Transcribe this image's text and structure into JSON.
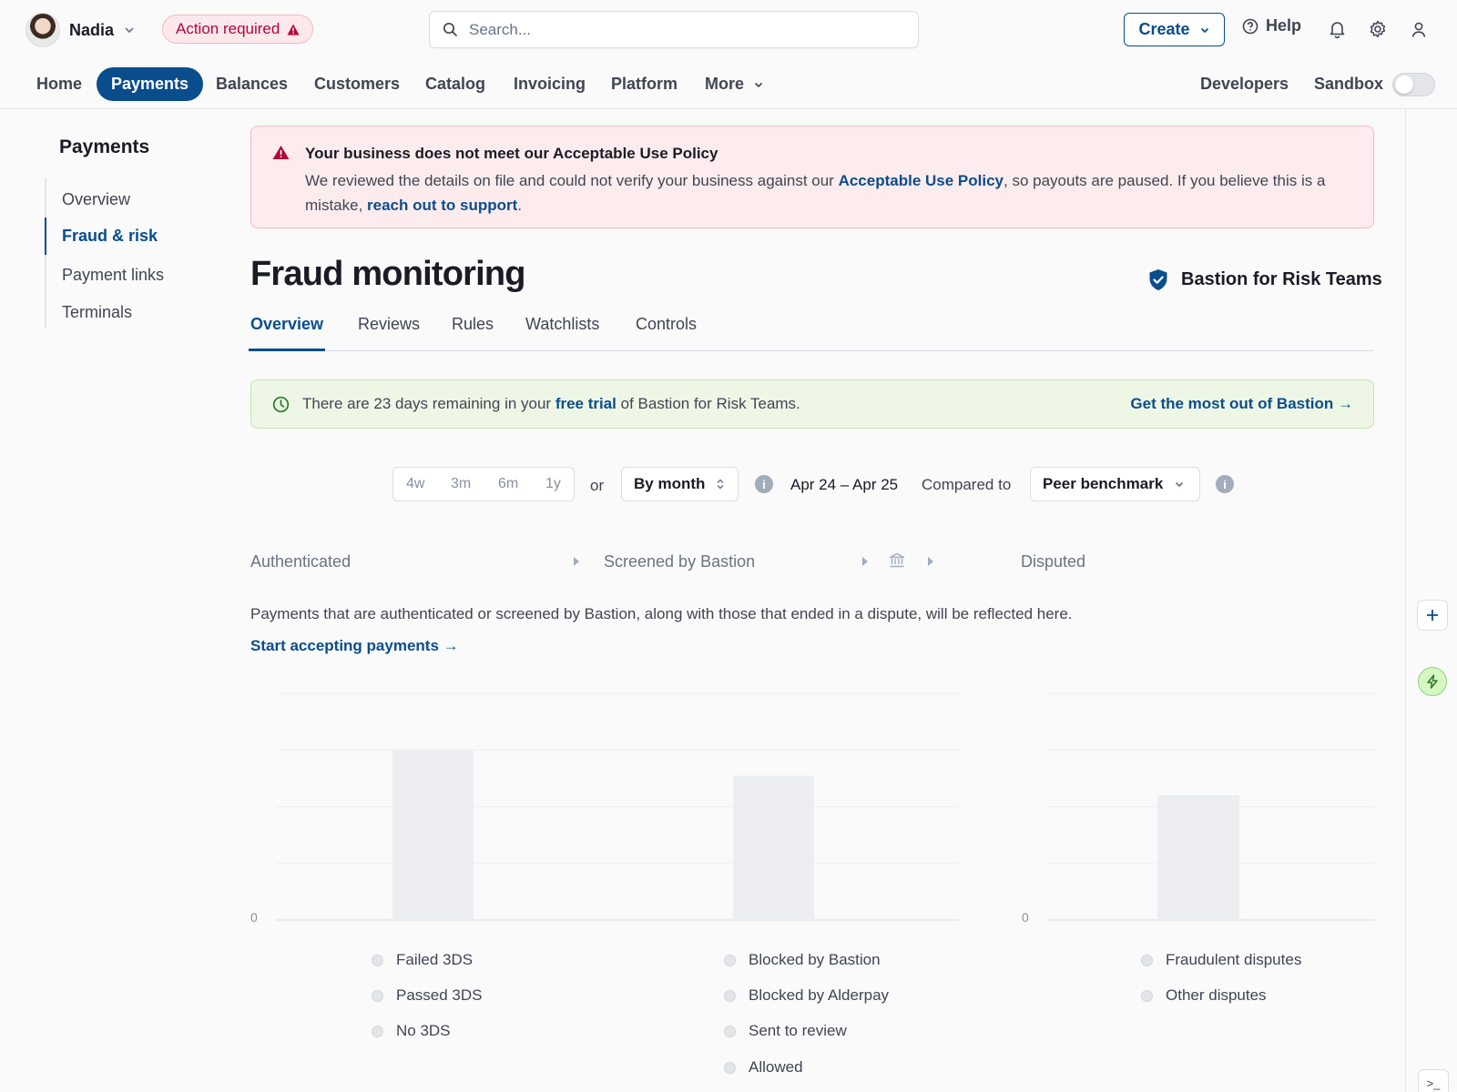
{
  "header": {
    "user_name": "Nadia",
    "action_badge": "Action required",
    "search_placeholder": "Search...",
    "create_label": "Create",
    "help_label": "Help"
  },
  "nav": {
    "items": [
      "Home",
      "Payments",
      "Balances",
      "Customers",
      "Catalog",
      "Invoicing",
      "Platform",
      "More"
    ],
    "active": "Payments",
    "developers": "Developers",
    "sandbox": "Sandbox",
    "sandbox_on": false
  },
  "sidebar": {
    "title": "Payments",
    "items": [
      "Overview",
      "Fraud & risk",
      "Payment links",
      "Terminals"
    ],
    "active": "Fraud & risk"
  },
  "policy_banner": {
    "title": "Your business does not meet our Acceptable Use Policy",
    "body_1": "We reviewed the details on file and could not verify your business against our ",
    "link_1": "Acceptable Use Policy",
    "body_2": ", so payouts are paused. If you believe this is a mistake, ",
    "link_2": "reach out to support",
    "body_3": "."
  },
  "page": {
    "title": "Fraud monitoring",
    "product_badge": "Bastion for Risk Teams"
  },
  "tabs": [
    "Overview",
    "Reviews",
    "Rules",
    "Watchlists",
    "Controls"
  ],
  "active_tab": "Overview",
  "trial_banner": {
    "text_1": "There are 23 days remaining in your ",
    "link": "free trial",
    "text_2": " of Bastion for Risk Teams.",
    "cta": "Get the most out of Bastion →"
  },
  "filters": {
    "ranges": [
      "4w",
      "3m",
      "6m",
      "1y"
    ],
    "or": "or",
    "interval": "By month",
    "date_range": "Apr 24 – Apr 25",
    "compared_label": "Compared to",
    "comparison": "Peer benchmark"
  },
  "funnel": {
    "steps": [
      "Authenticated",
      "Screened by Bastion",
      "Disputed"
    ]
  },
  "empty_state": {
    "text": "Payments that are authenticated or screened by Bastion, along with those that ended in a dispute, will be reflected here.",
    "link": "Start accepting payments →"
  },
  "chart_data": [
    {
      "type": "bar",
      "title": "",
      "ylim": [
        0,
        4
      ],
      "yticks": [
        "0"
      ],
      "grid": true,
      "placeholder": true,
      "series": [
        {
          "values": [
            3.0,
            2.55
          ]
        }
      ],
      "legend": [
        "Failed 3DS",
        "Passed 3DS",
        "No 3DS",
        "Blocked by Bastion",
        "Blocked by Alderpay",
        "Sent to review",
        "Allowed"
      ]
    },
    {
      "type": "bar",
      "title": "",
      "ylim": [
        0,
        4
      ],
      "yticks": [
        "0"
      ],
      "grid": true,
      "placeholder": true,
      "series": [
        {
          "values": [
            2.2
          ]
        }
      ],
      "legend": [
        "Fraudulent disputes",
        "Other disputes"
      ]
    }
  ],
  "colors": {
    "accent": "#0a4d8c",
    "danger": "#b3063c",
    "danger_bg": "#fdecee",
    "success_bg": "#eef7e6",
    "bar_placeholder": "#eceef1"
  }
}
